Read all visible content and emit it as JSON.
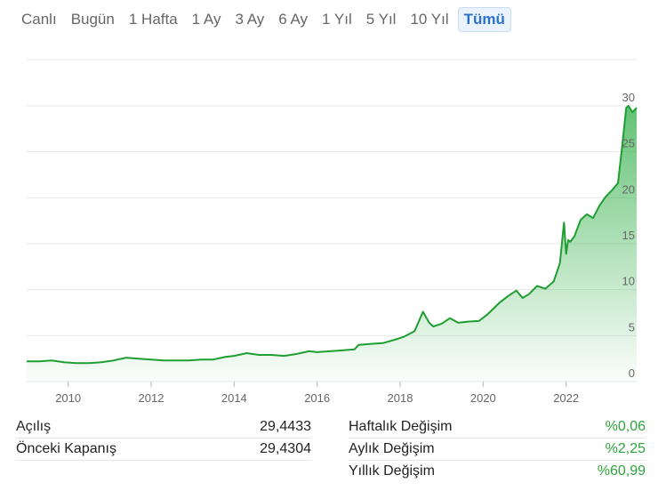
{
  "tabs": [
    {
      "label": "Canlı",
      "active": false
    },
    {
      "label": "Bugün",
      "active": false
    },
    {
      "label": "1 Hafta",
      "active": false
    },
    {
      "label": "1 Ay",
      "active": false
    },
    {
      "label": "3 Ay",
      "active": false
    },
    {
      "label": "6 Ay",
      "active": false
    },
    {
      "label": "1 Yıl",
      "active": false
    },
    {
      "label": "5 Yıl",
      "active": false
    },
    {
      "label": "10 Yıl",
      "active": false
    },
    {
      "label": "Tümü",
      "active": true
    }
  ],
  "colors": {
    "accent": "#2a72c9",
    "line": "#1f9e32",
    "positive": "#2ea43c"
  },
  "chart_data": {
    "type": "area",
    "xlim": [
      2009.0,
      2023.7
    ],
    "ylim": [
      0,
      30
    ],
    "x_ticks": [
      2010,
      2012,
      2014,
      2016,
      2018,
      2020,
      2022
    ],
    "x_tick_labels": [
      "2010",
      "2012",
      "2014",
      "2016",
      "2018",
      "2020",
      "2022"
    ],
    "y_ticks": [
      0,
      5,
      10,
      15,
      20,
      25,
      30
    ],
    "y_tick_labels": [
      "0",
      "5",
      "10",
      "15",
      "20",
      "25",
      "30"
    ],
    "grid": true,
    "series": [
      {
        "x": [
          2009.0,
          2009.3,
          2009.6,
          2009.9,
          2010.2,
          2010.5,
          2010.8,
          2011.1,
          2011.4,
          2011.7,
          2012.0,
          2012.3,
          2012.6,
          2012.9,
          2013.2,
          2013.5,
          2013.8,
          2014.0,
          2014.3,
          2014.6,
          2014.9,
          2015.2,
          2015.5,
          2015.8,
          2016.0,
          2016.3,
          2016.6,
          2016.9,
          2017.0,
          2017.3,
          2017.6,
          2017.9,
          2018.1,
          2018.35,
          2018.55,
          2018.7,
          2018.8,
          2019.0,
          2019.2,
          2019.4,
          2019.6,
          2019.9,
          2020.1,
          2020.4,
          2020.6,
          2020.8,
          2020.95,
          2021.1,
          2021.3,
          2021.5,
          2021.7,
          2021.85,
          2021.95,
          2022.0,
          2022.05,
          2022.1,
          2022.2,
          2022.35,
          2022.5,
          2022.65,
          2022.8,
          2022.95,
          2023.1,
          2023.25,
          2023.35,
          2023.45,
          2023.5,
          2023.6,
          2023.7
        ],
        "y": [
          2.2,
          2.2,
          2.3,
          2.1,
          2.0,
          2.0,
          2.1,
          2.3,
          2.6,
          2.5,
          2.4,
          2.3,
          2.3,
          2.3,
          2.4,
          2.4,
          2.7,
          2.8,
          3.1,
          2.9,
          2.9,
          2.8,
          3.0,
          3.3,
          3.2,
          3.3,
          3.4,
          3.5,
          4.0,
          4.1,
          4.2,
          4.6,
          4.9,
          5.5,
          7.6,
          6.4,
          6.0,
          6.3,
          6.9,
          6.4,
          6.5,
          6.6,
          7.3,
          8.6,
          9.3,
          9.9,
          9.1,
          9.5,
          10.4,
          10.1,
          10.9,
          12.9,
          17.3,
          13.9,
          15.4,
          15.2,
          15.8,
          17.6,
          18.2,
          17.8,
          19.1,
          20.1,
          20.8,
          21.6,
          25.6,
          29.8,
          30.0,
          29.3,
          29.8
        ]
      }
    ]
  },
  "stats": {
    "left": [
      {
        "label": "Açılış",
        "value": "29,4433"
      },
      {
        "label": "Önceki Kapanış",
        "value": "29,4304"
      }
    ],
    "right": [
      {
        "label": "Haftalık Değişim",
        "value": "%0,06"
      },
      {
        "label": "Aylık Değişim",
        "value": "%2,25"
      },
      {
        "label": "Yıllık Değişim",
        "value": "%60,99"
      }
    ]
  }
}
